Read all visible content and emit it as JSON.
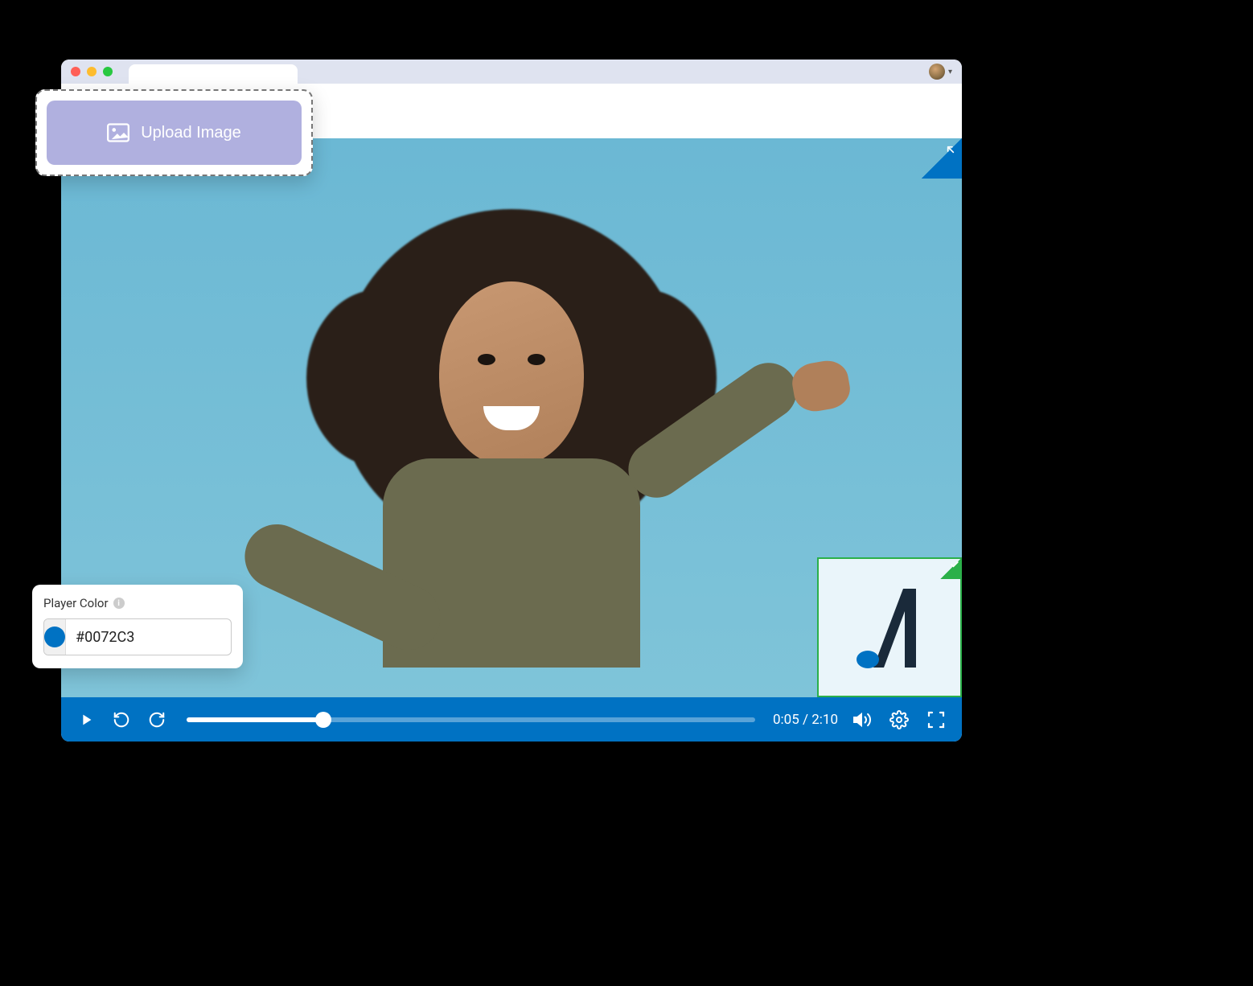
{
  "upload": {
    "button_label": "Upload Image"
  },
  "color_picker": {
    "label": "Player Color",
    "value": "#0072C3",
    "swatch_color": "#0072C3"
  },
  "player": {
    "current_time": "0:05",
    "duration": "2:10",
    "time_display": "0:05 / 2:10",
    "progress_percent": 24,
    "bar_color": "#0072C3"
  },
  "logo_overlay": {
    "border_color": "#2bb04a",
    "bg_color": "#eaf5fa"
  }
}
